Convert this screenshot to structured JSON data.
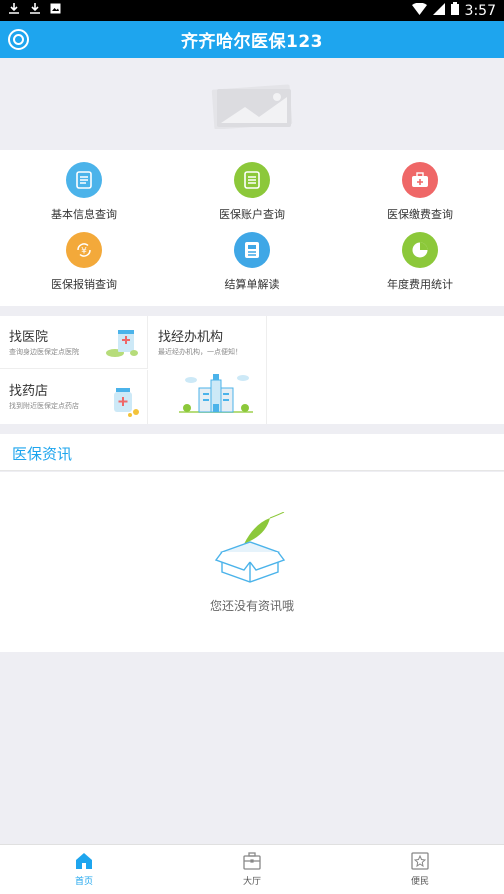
{
  "status_bar": {
    "time": "3:57",
    "icons_left": [
      "download-icon",
      "download-icon",
      "image-icon"
    ],
    "icons_right": [
      "wifi-icon",
      "signal-icon",
      "battery-icon"
    ]
  },
  "header": {
    "title": "齐齐哈尔医保123",
    "color": "#1ea5ee"
  },
  "services": [
    {
      "label": "基本信息查询",
      "icon": "document-icon",
      "color": "#4bb3ea"
    },
    {
      "label": "医保账户查询",
      "icon": "list-icon",
      "color": "#8cc83a"
    },
    {
      "label": "医保缴费查询",
      "icon": "medkit-icon",
      "color": "#ef6767"
    },
    {
      "label": "医保报销查询",
      "icon": "yuan-refresh-icon",
      "color": "#f3a93a"
    },
    {
      "label": "结算单解读",
      "icon": "card-icon",
      "color": "#3fa7e6"
    },
    {
      "label": "年度费用统计",
      "icon": "pie-chart-icon",
      "color": "#8cc83a"
    }
  ],
  "finds": {
    "hospital": {
      "title": "找医院",
      "subtitle": "查询身边医保定点医院"
    },
    "pharmacy": {
      "title": "找药店",
      "subtitle": "找到附近医保定点药店"
    },
    "agency": {
      "title": "找经办机构",
      "subtitle": "最近经办机构，一点便知！"
    }
  },
  "news": {
    "title": "医保资讯",
    "empty_text": "您还没有资讯哦"
  },
  "bottom_nav": [
    {
      "label": "首页",
      "icon": "home-icon",
      "active": true
    },
    {
      "label": "大厅",
      "icon": "briefcase-icon",
      "active": false
    },
    {
      "label": "便民",
      "icon": "star-icon",
      "active": false
    }
  ]
}
